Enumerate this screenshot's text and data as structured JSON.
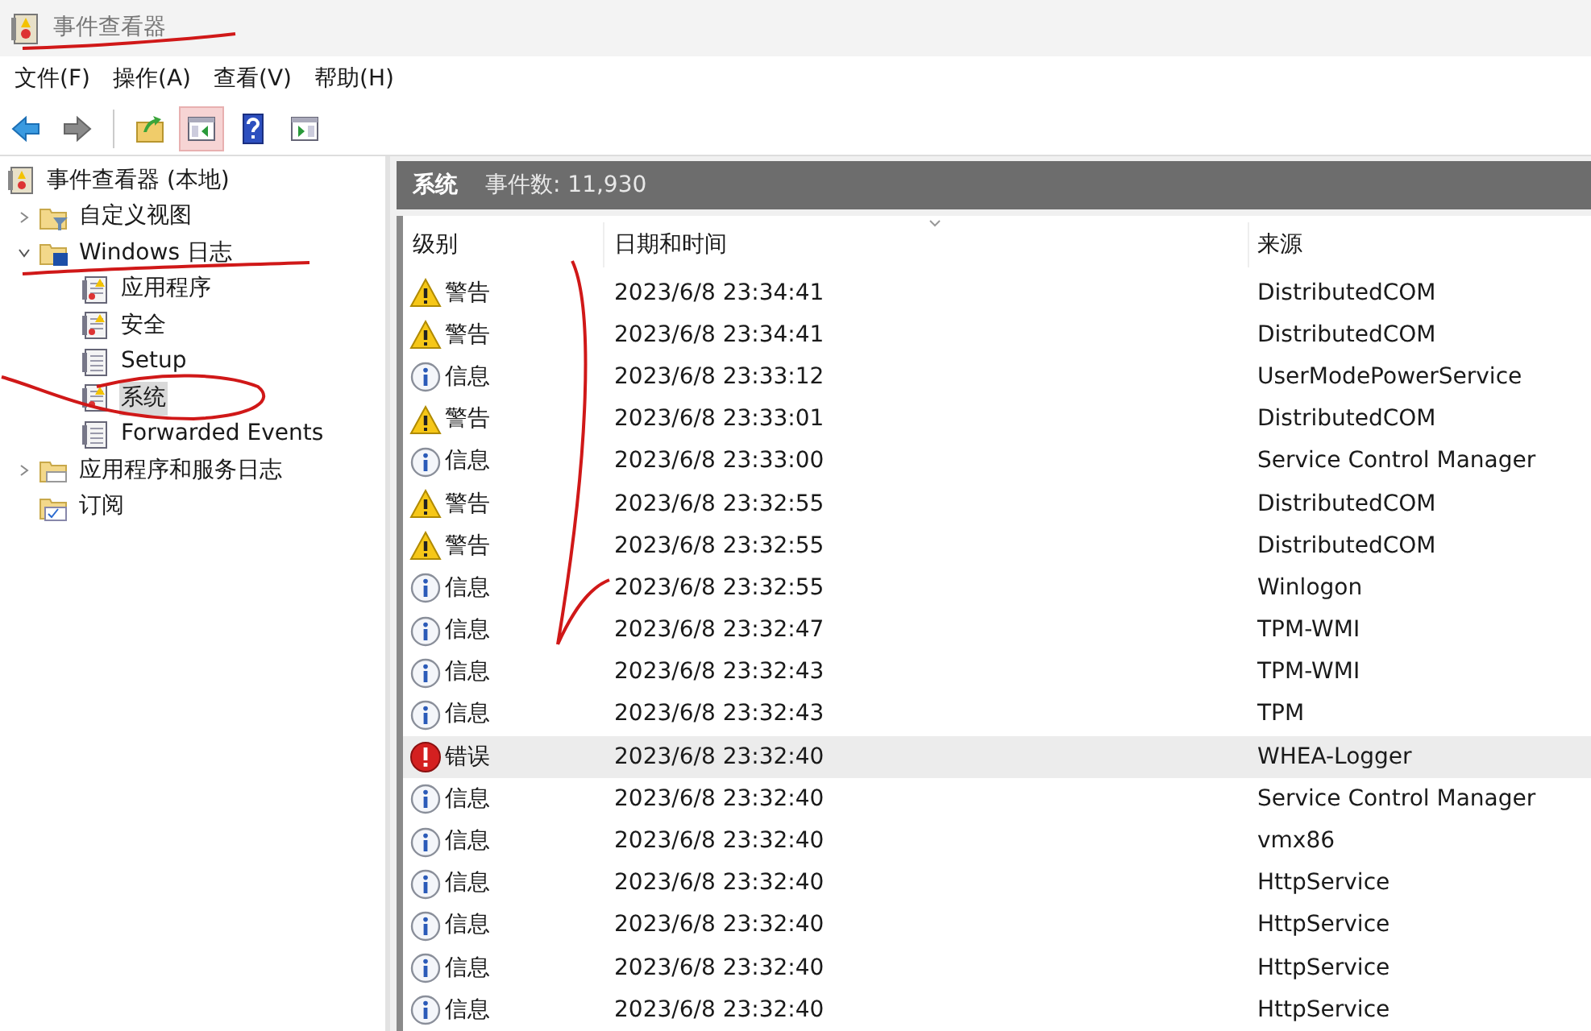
{
  "window": {
    "title": "事件查看器"
  },
  "menu": [
    "文件(F)",
    "操作(A)",
    "查看(V)",
    "帮助(H)"
  ],
  "toolbar": [
    {
      "kind": "back",
      "pressed": false
    },
    {
      "kind": "forward",
      "pressed": false
    },
    {
      "kind": "up",
      "pressed": false
    },
    {
      "kind": "console-tree",
      "pressed": true
    },
    {
      "kind": "help",
      "pressed": false
    },
    {
      "kind": "action-pane",
      "pressed": false
    }
  ],
  "tree": [
    {
      "label": "事件查看器 (本地)",
      "kind": "viewer",
      "selected": false,
      "children": [
        {
          "label": "自定义视图",
          "kind": "filter-folder",
          "selected": false,
          "expanded": false
        },
        {
          "label": "Windows 日志",
          "kind": "log-folder",
          "selected": false,
          "expanded": true,
          "children": [
            {
              "label": "应用程序",
              "kind": "alert-log",
              "selected": false
            },
            {
              "label": "安全",
              "kind": "alert-log",
              "selected": false
            },
            {
              "label": "Setup",
              "kind": "log",
              "selected": false
            },
            {
              "label": "系统",
              "kind": "alert-log",
              "selected": true
            },
            {
              "label": "Forwarded Events",
              "kind": "log",
              "selected": false
            }
          ]
        },
        {
          "label": "应用程序和服务日志",
          "kind": "folder",
          "selected": false,
          "expanded": false
        },
        {
          "label": "订阅",
          "kind": "subscription",
          "selected": false
        }
      ]
    }
  ],
  "panel": {
    "title": "系统",
    "count": "事件数: 11,930"
  },
  "table": {
    "columns": [
      "级别",
      "日期和时间",
      "来源"
    ],
    "rows": [
      {
        "kind": "warning",
        "level": "警告",
        "datetime": "2023/6/8 23:34:41",
        "source": "DistributedCOM",
        "selected": false
      },
      {
        "kind": "warning",
        "level": "警告",
        "datetime": "2023/6/8 23:34:41",
        "source": "DistributedCOM",
        "selected": false
      },
      {
        "kind": "info",
        "level": "信息",
        "datetime": "2023/6/8 23:33:12",
        "source": "UserModePowerService",
        "selected": false
      },
      {
        "kind": "warning",
        "level": "警告",
        "datetime": "2023/6/8 23:33:01",
        "source": "DistributedCOM",
        "selected": false
      },
      {
        "kind": "info",
        "level": "信息",
        "datetime": "2023/6/8 23:33:00",
        "source": "Service Control Manager",
        "selected": false
      },
      {
        "kind": "warning",
        "level": "警告",
        "datetime": "2023/6/8 23:32:55",
        "source": "DistributedCOM",
        "selected": false
      },
      {
        "kind": "warning",
        "level": "警告",
        "datetime": "2023/6/8 23:32:55",
        "source": "DistributedCOM",
        "selected": false
      },
      {
        "kind": "info",
        "level": "信息",
        "datetime": "2023/6/8 23:32:55",
        "source": "Winlogon",
        "selected": false
      },
      {
        "kind": "info",
        "level": "信息",
        "datetime": "2023/6/8 23:32:47",
        "source": "TPM-WMI",
        "selected": false
      },
      {
        "kind": "info",
        "level": "信息",
        "datetime": "2023/6/8 23:32:43",
        "source": "TPM-WMI",
        "selected": false
      },
      {
        "kind": "info",
        "level": "信息",
        "datetime": "2023/6/8 23:32:43",
        "source": "TPM",
        "selected": false
      },
      {
        "kind": "error",
        "level": "错误",
        "datetime": "2023/6/8 23:32:40",
        "source": "WHEA-Logger",
        "selected": true
      },
      {
        "kind": "info",
        "level": "信息",
        "datetime": "2023/6/8 23:32:40",
        "source": "Service Control Manager",
        "selected": false
      },
      {
        "kind": "info",
        "level": "信息",
        "datetime": "2023/6/8 23:32:40",
        "source": "vmx86",
        "selected": false
      },
      {
        "kind": "info",
        "level": "信息",
        "datetime": "2023/6/8 23:32:40",
        "source": "HttpService",
        "selected": false
      },
      {
        "kind": "info",
        "level": "信息",
        "datetime": "2023/6/8 23:32:40",
        "source": "HttpService",
        "selected": false
      },
      {
        "kind": "info",
        "level": "信息",
        "datetime": "2023/6/8 23:32:40",
        "source": "HttpService",
        "selected": false
      },
      {
        "kind": "info",
        "level": "信息",
        "datetime": "2023/6/8 23:32:40",
        "source": "HttpService",
        "selected": false
      }
    ]
  }
}
